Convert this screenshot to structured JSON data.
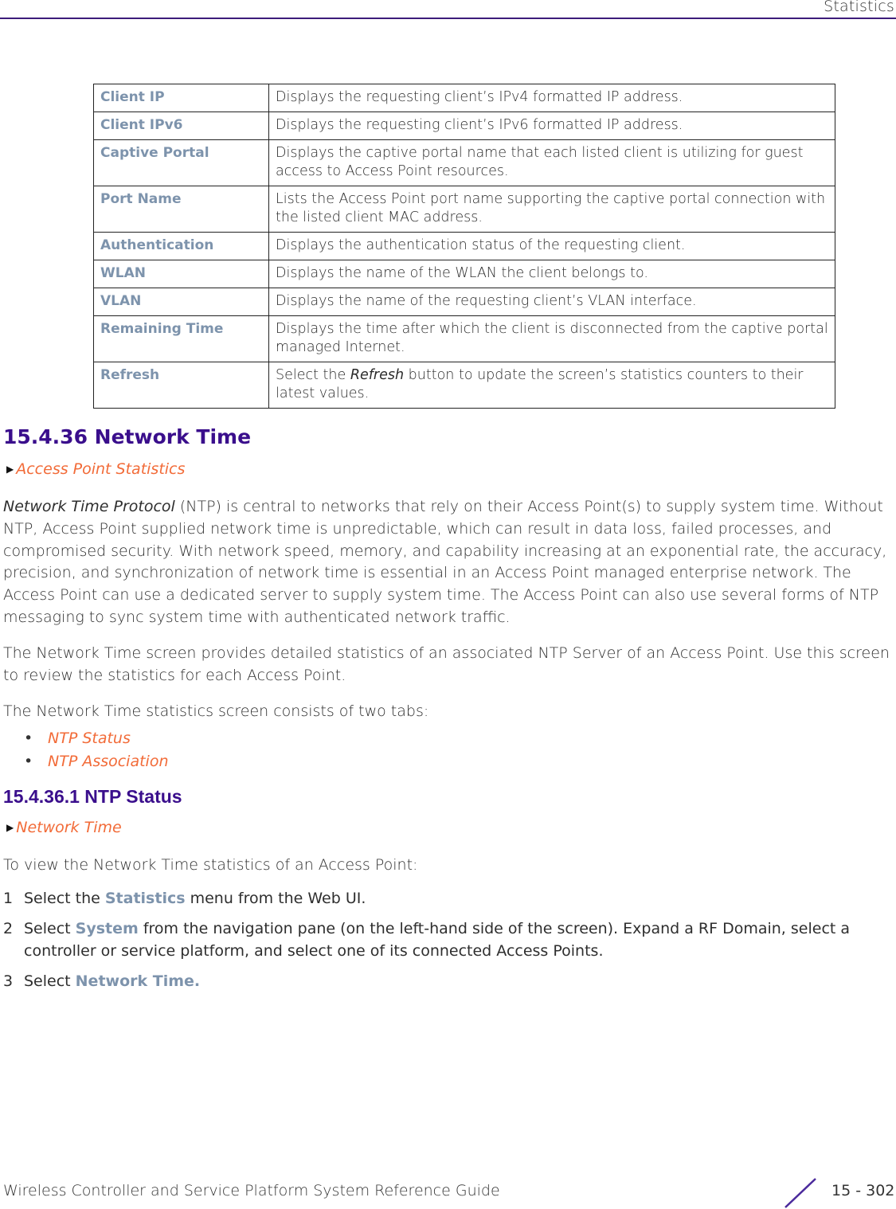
{
  "header": {
    "title": "Statistics"
  },
  "table": {
    "rows": [
      {
        "term": "Client IP",
        "definition": "Displays the requesting client’s IPv4 formatted IP address."
      },
      {
        "term": "Client IPv6",
        "definition": "Displays the requesting client’s IPv6 formatted IP address."
      },
      {
        "term": "Captive Portal",
        "definition": "Displays the captive portal name that each listed client is utilizing for guest access to Access Point resources."
      },
      {
        "term": "Port Name",
        "definition": "Lists the Access Point port name supporting the captive portal connection with the listed client MAC address."
      },
      {
        "term": "Authentication",
        "definition": "Displays the authentication status of the requesting client."
      },
      {
        "term": "WLAN",
        "definition": "Displays the name of the WLAN the client belongs to."
      },
      {
        "term": "VLAN",
        "definition": "Displays the name of the requesting client’s VLAN interface."
      },
      {
        "term": "Remaining Time",
        "definition": "Displays the time after which the client is disconnected from the captive portal managed Internet."
      },
      {
        "term": "Refresh",
        "definition_pre": "Select the ",
        "definition_em": "Refresh",
        "definition_post": " button to update the screen’s statistics counters to their latest values."
      }
    ]
  },
  "section": {
    "heading": "15.4.36  Network Time",
    "xref": "Access Point Statistics",
    "intro_em": "Network Time Protocol",
    "intro_rest": " (NTP) is central to networks that rely on their Access Point(s) to supply system time. Without NTP, Access Point supplied network time is unpredictable, which can result in data loss, failed processes, and compromised security. With network speed, memory, and capability increasing at an exponential rate, the accuracy, precision, and synchronization of network time is essential in an Access Point managed enterprise network. The Access Point can use a dedicated server to supply system time. The Access Point can also use several forms of NTP messaging to sync system time with authenticated network traffic.",
    "para2": "The Network Time screen provides detailed statistics of an associated NTP Server of an Access Point. Use this screen to review the statistics for each Access Point.",
    "para3": "The Network Time statistics screen consists of two tabs:",
    "tabs": [
      "NTP Status",
      "NTP Association"
    ]
  },
  "subsection": {
    "heading": "15.4.36.1  NTP Status",
    "xref": "Network Time",
    "lead": "To view the Network Time statistics of an Access Point:",
    "steps": [
      {
        "num": "1",
        "pre": "Select the ",
        "ui": "Statistics",
        "post": " menu from the Web UI."
      },
      {
        "num": "2",
        "pre": "Select ",
        "ui": "System",
        "post": " from the navigation pane (on the left-hand side of the screen). Expand a RF Domain, select a controller or service platform, and select one of its connected Access Points."
      },
      {
        "num": "3",
        "pre": "Select ",
        "ui": "Network Time.",
        "post": ""
      }
    ]
  },
  "footer": {
    "guide": "Wireless Controller and Service Platform System Reference Guide",
    "page": "15 - 302"
  },
  "colors": {
    "heading": "#3a0e8c",
    "link": "#f26b38",
    "ui_ref": "#7d93ac",
    "rule": "#3d1c7a"
  }
}
